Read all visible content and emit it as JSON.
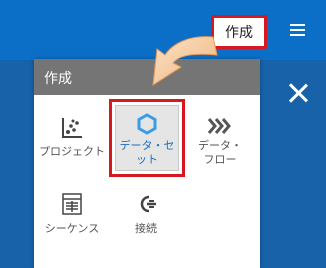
{
  "header": {
    "create_button_label": "作成"
  },
  "panel": {
    "title": "作成",
    "items": [
      {
        "label": "プロジェクト",
        "icon": "scatter-chart-icon"
      },
      {
        "label": "データ・セット",
        "icon": "hexagon-icon"
      },
      {
        "label": "データ・フロー",
        "icon": "chevrons-right-icon"
      },
      {
        "label": "シーケンス",
        "icon": "sequence-icon"
      },
      {
        "label": "接続",
        "icon": "plug-icon"
      }
    ]
  },
  "colors": {
    "topbar": "#0b6fc8",
    "highlight_border": "#d81820",
    "panel_header": "#757575",
    "accent": "#1a6fc0"
  }
}
